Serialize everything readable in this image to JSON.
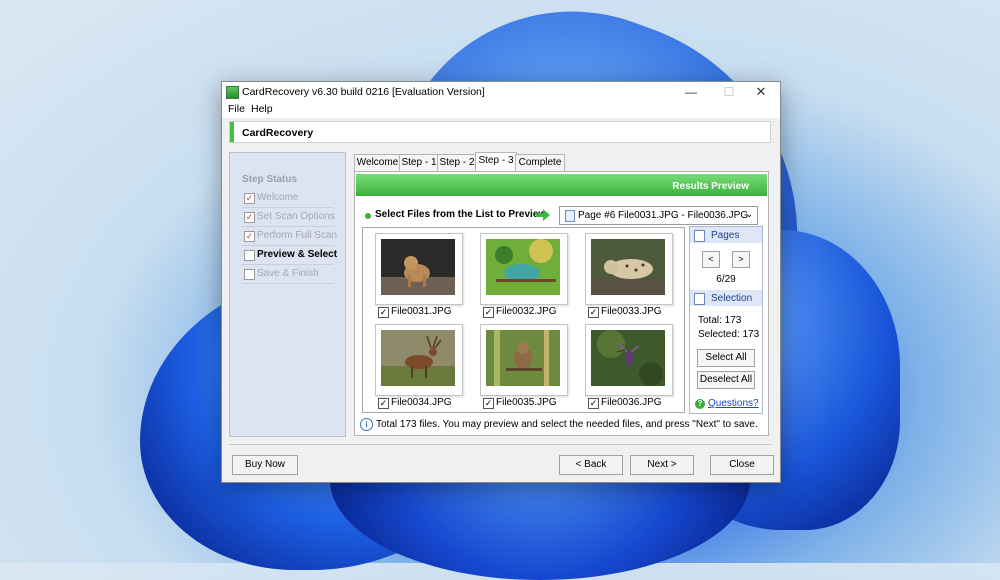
{
  "window": {
    "title": "CardRecovery v6.30 build 0216 [Evaluation Version]",
    "controls": {
      "minimize": "—",
      "maximize": "☐",
      "close": "✕"
    }
  },
  "menu": [
    "File",
    "Help"
  ],
  "header_title": "CardRecovery",
  "step_status": {
    "title": "Step Status",
    "items": [
      {
        "label": "Welcome",
        "checked": true
      },
      {
        "label": "Set Scan Options",
        "checked": true
      },
      {
        "label": "Perform Full Scan",
        "checked": true
      },
      {
        "label": "Preview & Select",
        "checked": false
      },
      {
        "label": "Save & Finish",
        "checked": false
      }
    ]
  },
  "tabs": [
    "Welcome",
    "Step - 1",
    "Step - 2",
    "Step - 3",
    "Complete"
  ],
  "results_title": "Results Preview",
  "select_label": "Select Files from the List to Preview",
  "page_select": "Page #6   File0031.JPG - File0036.JPG",
  "files": [
    {
      "name": "File0031.JPG",
      "checked": true
    },
    {
      "name": "File0032.JPG",
      "checked": true
    },
    {
      "name": "File0033.JPG",
      "checked": true
    },
    {
      "name": "File0034.JPG",
      "checked": true
    },
    {
      "name": "File0035.JPG",
      "checked": true
    },
    {
      "name": "File0036.JPG",
      "checked": true
    }
  ],
  "pages_panel": {
    "title": "Pages",
    "prev": "<",
    "next": ">",
    "count": "6/29"
  },
  "selection_panel": {
    "title": "Selection",
    "total_label": "Total:  173",
    "selected_label": "Selected: 173",
    "select_all": "Select All",
    "deselect_all": "Deselect All",
    "questions": "Questions?"
  },
  "info_text": "Total 173 files.  You may preview and select the needed files, and press \"Next\" to save.",
  "buttons": {
    "buy_now": "Buy Now",
    "back": "< Back",
    "next": "Next >",
    "close": "Close"
  }
}
